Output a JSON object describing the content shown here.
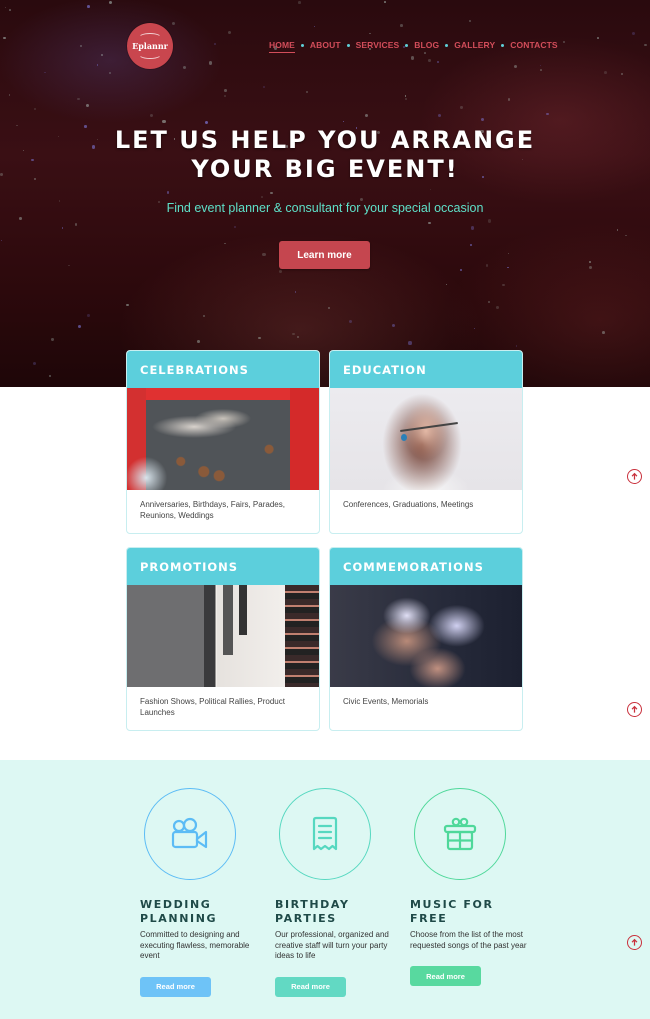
{
  "brand": {
    "logo_text": "Eplannr"
  },
  "nav": {
    "items": [
      {
        "label": "HOME",
        "active": true
      },
      {
        "label": "ABOUT",
        "active": false
      },
      {
        "label": "SERVICES",
        "active": false
      },
      {
        "label": "BLOG",
        "active": false
      },
      {
        "label": "GALLERY",
        "active": false
      },
      {
        "label": "CONTACTS",
        "active": false
      }
    ]
  },
  "hero": {
    "title_line1": "LET US HELP YOU ARRANGE",
    "title_line2": "YOUR BIG EVENT!",
    "subtitle": "Find event planner & consultant for your special occasion",
    "button_label": "Learn more"
  },
  "categories": [
    {
      "title": "CELEBRATIONS",
      "description": "Anniversaries, Birthdays, Fairs, Parades, Reunions, Weddings"
    },
    {
      "title": "EDUCATION",
      "description": "Conferences, Graduations, Meetings"
    },
    {
      "title": "PROMOTIONS",
      "description": "Fashion Shows, Political Rallies, Product Launches"
    },
    {
      "title": "COMMEMORATIONS",
      "description": "Civic Events, Memorials"
    }
  ],
  "features": [
    {
      "icon": "video-camera-icon",
      "title_line1": "WEDDING",
      "title_line2": "PLANNING",
      "description": "Committed to designing and executing flawless, memorable event",
      "button_label": "Read more",
      "color": "#5cbcf5"
    },
    {
      "icon": "receipt-icon",
      "title_line1": "BIRTHDAY",
      "title_line2": "PARTIES",
      "description": "Our professional, organized and creative staff will turn your party ideas to life",
      "button_label": "Read more",
      "color": "#56d8c0"
    },
    {
      "icon": "gift-icon",
      "title_line1": "MUSIC FOR",
      "title_line2": "FREE",
      "description": "Choose from the list of the most requested songs of the past year",
      "button_label": "Read more",
      "color": "#4fd89a"
    }
  ],
  "colors": {
    "accent_red": "#c9464e",
    "nav_red": "#d24d5a",
    "card_header": "#5ccfdc",
    "hero_subtitle": "#5ee0c8",
    "mint_bg": "#ddf8f3",
    "scroll_up": "#c9303c"
  },
  "scroll_up_icon": "arrow-up-circle-icon"
}
